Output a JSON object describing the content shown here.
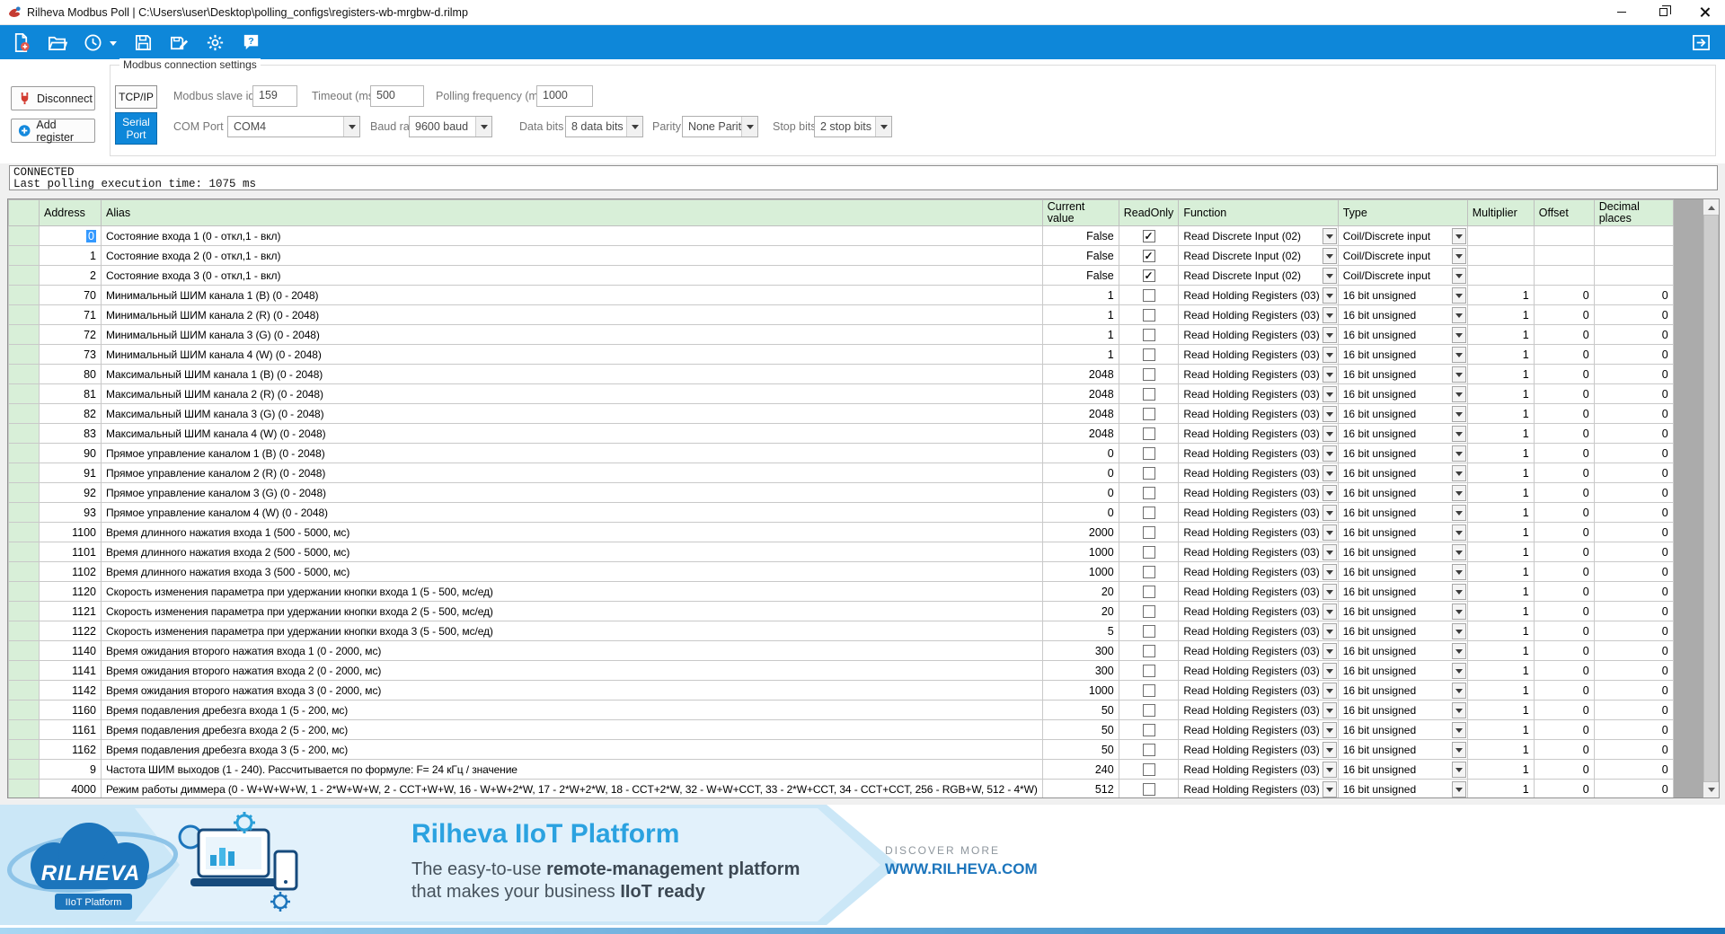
{
  "window": {
    "title": "Rilheva Modbus Poll | C:\\Users\\user\\Desktop\\polling_configs\\registers-wb-mrgbw-d.rilmp"
  },
  "toolbar": {
    "icons": [
      "new-file",
      "open-file",
      "history",
      "save",
      "save-as",
      "settings",
      "help"
    ],
    "right_icon": "side-panel-toggle"
  },
  "connection": {
    "group_label": "Modbus connection settings",
    "disconnect": "Disconnect",
    "add_register": "Add register",
    "tcp_button": "TCP/IP",
    "serial_button": "Serial Port",
    "slave_label": "Modbus slave id",
    "slave_value": "159",
    "timeout_label": "Timeout (ms)",
    "timeout_value": "500",
    "polling_label": "Polling frequency (ms)",
    "polling_value": "1000",
    "com_label": "COM Port",
    "com_value": "COM4",
    "baud_label": "Baud rate",
    "baud_value": "9600 baud",
    "databits_label": "Data bits",
    "databits_value": "8 data bits",
    "parity_label": "Parity",
    "parity_value": "None Parity",
    "stopbits_label": "Stop bits",
    "stopbits_value": "2 stop bits"
  },
  "status": {
    "line1": "CONNECTED",
    "line2": "Last polling execution time: 1075 ms"
  },
  "grid": {
    "headers": [
      "Address",
      "Alias",
      "Current value",
      "ReadOnly",
      "Function",
      "Type",
      "Multiplier",
      "Offset",
      "Decimal places"
    ],
    "rows": [
      {
        "address": "0",
        "alias": "Состояние входа 1 (0 - откл,1 - вкл)",
        "value": "False",
        "readonly": true,
        "function": "Read Discrete Input (02)",
        "type": "Coil/Discrete input",
        "multiplier": "",
        "offset": "",
        "decimals": ""
      },
      {
        "address": "1",
        "alias": "Состояние входа 2 (0 - откл,1 - вкл)",
        "value": "False",
        "readonly": true,
        "function": "Read Discrete Input (02)",
        "type": "Coil/Discrete input",
        "multiplier": "",
        "offset": "",
        "decimals": ""
      },
      {
        "address": "2",
        "alias": "Состояние входа 3 (0 - откл,1 - вкл)",
        "value": "False",
        "readonly": true,
        "function": "Read Discrete Input (02)",
        "type": "Coil/Discrete input",
        "multiplier": "",
        "offset": "",
        "decimals": ""
      },
      {
        "address": "70",
        "alias": "Минимальный ШИМ канала 1 (B) (0 - 2048)",
        "value": "1",
        "readonly": false,
        "function": "Read Holding Registers (03)",
        "type": "16 bit unsigned",
        "multiplier": "1",
        "offset": "0",
        "decimals": "0"
      },
      {
        "address": "71",
        "alias": "Минимальный ШИМ канала 2 (R) (0 - 2048)",
        "value": "1",
        "readonly": false,
        "function": "Read Holding Registers (03)",
        "type": "16 bit unsigned",
        "multiplier": "1",
        "offset": "0",
        "decimals": "0"
      },
      {
        "address": "72",
        "alias": "Минимальный ШИМ канала 3 (G) (0 - 2048)",
        "value": "1",
        "readonly": false,
        "function": "Read Holding Registers (03)",
        "type": "16 bit unsigned",
        "multiplier": "1",
        "offset": "0",
        "decimals": "0"
      },
      {
        "address": "73",
        "alias": "Минимальный ШИМ канала 4 (W) (0 - 2048)",
        "value": "1",
        "readonly": false,
        "function": "Read Holding Registers (03)",
        "type": "16 bit unsigned",
        "multiplier": "1",
        "offset": "0",
        "decimals": "0"
      },
      {
        "address": "80",
        "alias": "Максимальный ШИМ канала 1 (B) (0 - 2048)",
        "value": "2048",
        "readonly": false,
        "function": "Read Holding Registers (03)",
        "type": "16 bit unsigned",
        "multiplier": "1",
        "offset": "0",
        "decimals": "0"
      },
      {
        "address": "81",
        "alias": "Максимальный ШИМ канала 2 (R) (0 - 2048)",
        "value": "2048",
        "readonly": false,
        "function": "Read Holding Registers (03)",
        "type": "16 bit unsigned",
        "multiplier": "1",
        "offset": "0",
        "decimals": "0"
      },
      {
        "address": "82",
        "alias": "Максимальный ШИМ канала 3 (G) (0 - 2048)",
        "value": "2048",
        "readonly": false,
        "function": "Read Holding Registers (03)",
        "type": "16 bit unsigned",
        "multiplier": "1",
        "offset": "0",
        "decimals": "0"
      },
      {
        "address": "83",
        "alias": "Максимальный ШИМ канала 4 (W) (0 - 2048)",
        "value": "2048",
        "readonly": false,
        "function": "Read Holding Registers (03)",
        "type": "16 bit unsigned",
        "multiplier": "1",
        "offset": "0",
        "decimals": "0"
      },
      {
        "address": "90",
        "alias": "Прямое управление каналом 1 (B) (0 - 2048)",
        "value": "0",
        "readonly": false,
        "function": "Read Holding Registers (03)",
        "type": "16 bit unsigned",
        "multiplier": "1",
        "offset": "0",
        "decimals": "0"
      },
      {
        "address": "91",
        "alias": "Прямое управление каналом 2 (R) (0 - 2048)",
        "value": "0",
        "readonly": false,
        "function": "Read Holding Registers (03)",
        "type": "16 bit unsigned",
        "multiplier": "1",
        "offset": "0",
        "decimals": "0"
      },
      {
        "address": "92",
        "alias": "Прямое управление каналом 3 (G) (0 - 2048)",
        "value": "0",
        "readonly": false,
        "function": "Read Holding Registers (03)",
        "type": "16 bit unsigned",
        "multiplier": "1",
        "offset": "0",
        "decimals": "0"
      },
      {
        "address": "93",
        "alias": "Прямое управление каналом 4 (W) (0 - 2048)",
        "value": "0",
        "readonly": false,
        "function": "Read Holding Registers (03)",
        "type": "16 bit unsigned",
        "multiplier": "1",
        "offset": "0",
        "decimals": "0"
      },
      {
        "address": "1100",
        "alias": "Время длинного нажатия входа 1 (500 - 5000, мс)",
        "value": "2000",
        "readonly": false,
        "function": "Read Holding Registers (03)",
        "type": "16 bit unsigned",
        "multiplier": "1",
        "offset": "0",
        "decimals": "0"
      },
      {
        "address": "1101",
        "alias": "Время длинного нажатия входа 2 (500 - 5000, мс)",
        "value": "1000",
        "readonly": false,
        "function": "Read Holding Registers (03)",
        "type": "16 bit unsigned",
        "multiplier": "1",
        "offset": "0",
        "decimals": "0"
      },
      {
        "address": "1102",
        "alias": "Время длинного нажатия входа 3 (500 - 5000, мс)",
        "value": "1000",
        "readonly": false,
        "function": "Read Holding Registers (03)",
        "type": "16 bit unsigned",
        "multiplier": "1",
        "offset": "0",
        "decimals": "0"
      },
      {
        "address": "1120",
        "alias": "Скорость изменения параметра при удержании кнопки входа 1 (5 - 500, мс/ед)",
        "value": "20",
        "readonly": false,
        "function": "Read Holding Registers (03)",
        "type": "16 bit unsigned",
        "multiplier": "1",
        "offset": "0",
        "decimals": "0"
      },
      {
        "address": "1121",
        "alias": "Скорость изменения параметра при удержании кнопки входа 2 (5 - 500, мс/ед)",
        "value": "20",
        "readonly": false,
        "function": "Read Holding Registers (03)",
        "type": "16 bit unsigned",
        "multiplier": "1",
        "offset": "0",
        "decimals": "0"
      },
      {
        "address": "1122",
        "alias": "Скорость изменения параметра при удержании кнопки входа 3 (5 - 500, мс/ед)",
        "value": "5",
        "readonly": false,
        "function": "Read Holding Registers (03)",
        "type": "16 bit unsigned",
        "multiplier": "1",
        "offset": "0",
        "decimals": "0"
      },
      {
        "address": "1140",
        "alias": "Время ожидания второго нажатия входа 1 (0 - 2000, мс)",
        "value": "300",
        "readonly": false,
        "function": "Read Holding Registers (03)",
        "type": "16 bit unsigned",
        "multiplier": "1",
        "offset": "0",
        "decimals": "0"
      },
      {
        "address": "1141",
        "alias": "Время ожидания второго нажатия входа 2 (0 - 2000, мс)",
        "value": "300",
        "readonly": false,
        "function": "Read Holding Registers (03)",
        "type": "16 bit unsigned",
        "multiplier": "1",
        "offset": "0",
        "decimals": "0"
      },
      {
        "address": "1142",
        "alias": "Время ожидания второго нажатия входа 3 (0 - 2000, мс)",
        "value": "1000",
        "readonly": false,
        "function": "Read Holding Registers (03)",
        "type": "16 bit unsigned",
        "multiplier": "1",
        "offset": "0",
        "decimals": "0"
      },
      {
        "address": "1160",
        "alias": "Время подавления дребезга входа 1 (5 - 200, мс)",
        "value": "50",
        "readonly": false,
        "function": "Read Holding Registers (03)",
        "type": "16 bit unsigned",
        "multiplier": "1",
        "offset": "0",
        "decimals": "0"
      },
      {
        "address": "1161",
        "alias": "Время подавления дребезга входа 2 (5 - 200, мс)",
        "value": "50",
        "readonly": false,
        "function": "Read Holding Registers (03)",
        "type": "16 bit unsigned",
        "multiplier": "1",
        "offset": "0",
        "decimals": "0"
      },
      {
        "address": "1162",
        "alias": "Время подавления дребезга входа 3 (5 - 200, мс)",
        "value": "50",
        "readonly": false,
        "function": "Read Holding Registers (03)",
        "type": "16 bit unsigned",
        "multiplier": "1",
        "offset": "0",
        "decimals": "0"
      },
      {
        "address": "9",
        "alias": "Частота ШИМ выходов (1 - 240). Рассчитывается по формуле: F= 24 кГц / значение",
        "value": "240",
        "readonly": false,
        "function": "Read Holding Registers (03)",
        "type": "16 bit unsigned",
        "multiplier": "1",
        "offset": "0",
        "decimals": "0"
      },
      {
        "address": "4000",
        "alias": "Режим работы диммера (0 - W+W+W+W, 1 - 2*W+W+W, 2 - CCT+W+W, 16 - W+W+2*W, 17 - 2*W+2*W, 18 - CCT+2*W, 32 - W+W+CCT, 33 - 2*W+CCT, 34 - CCT+CCT, 256 - RGB+W, 512 - 4*W)",
        "value": "512",
        "readonly": false,
        "function": "Read Holding Registers (03)",
        "type": "16 bit unsigned",
        "multiplier": "1",
        "offset": "0",
        "decimals": "0"
      }
    ]
  },
  "banner": {
    "logo_text": "RILHEVA",
    "logo_subtext": "IIoT Platform",
    "title": "Rilheva IIoT Platform",
    "line1_normal": "The easy-to-use ",
    "line1_bold": "remote-management platform",
    "line2_normal": "that makes your business ",
    "line2_bold": "IIoT ready",
    "discover": "DISCOVER MORE",
    "website": "WWW.RILHEVA.COM"
  },
  "colors": {
    "toolbar_blue": "#0e87d9",
    "accent_blue": "#1c75bc",
    "grid_header_green": "#d8efd8",
    "banner_light_blue": "#cbe7f7",
    "banner_title_blue": "#2ba2e0",
    "grid_background_gray": "#ababab"
  }
}
